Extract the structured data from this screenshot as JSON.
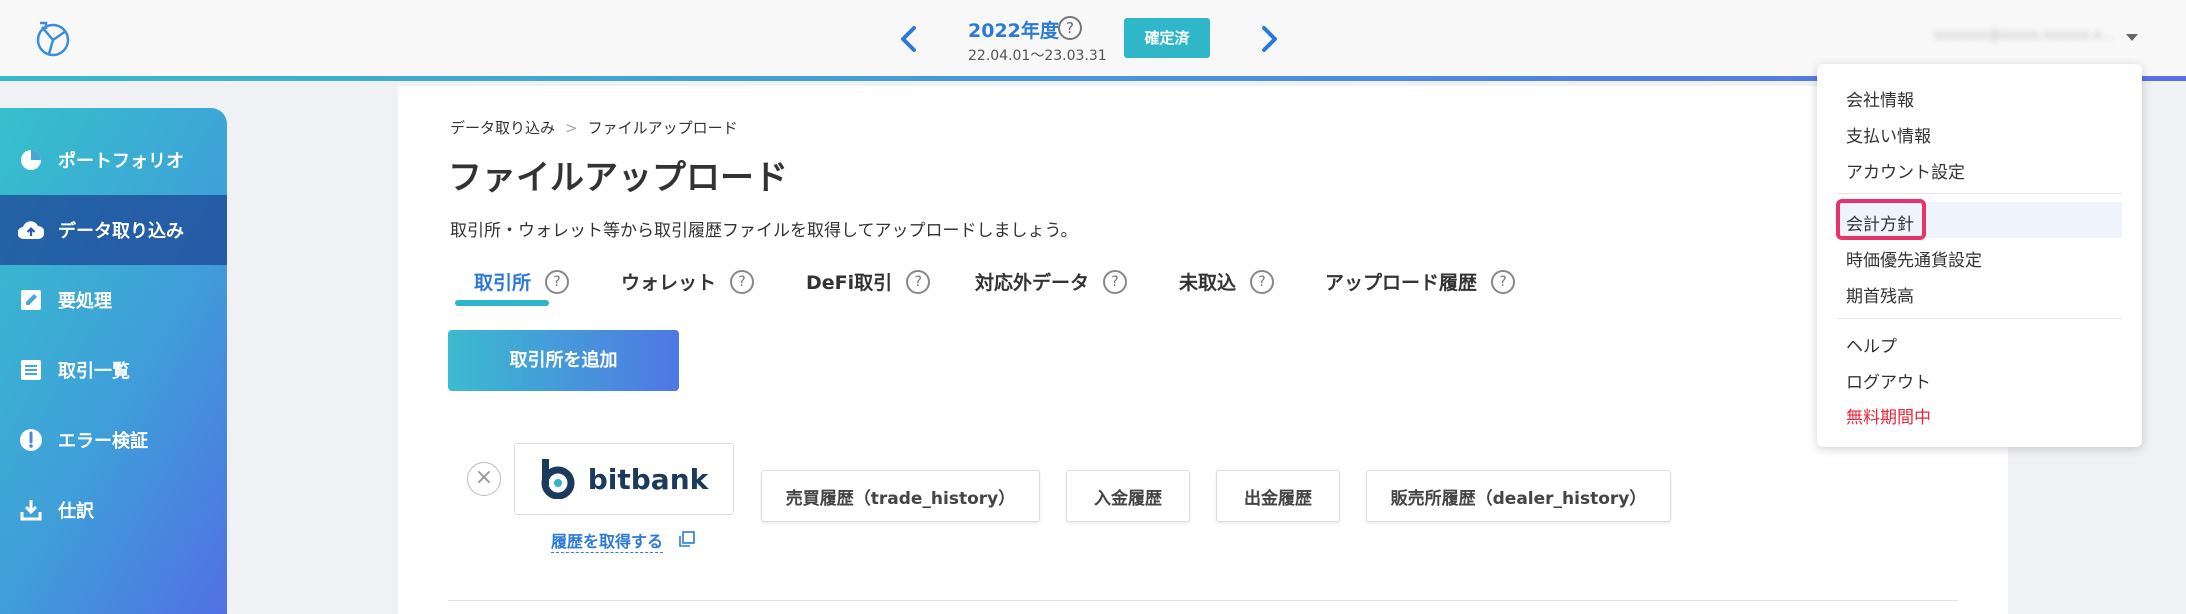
{
  "header": {
    "year_label": "2022年度",
    "year_help": "?",
    "period": "22.04.01〜23.03.31",
    "status_badge": "確定済",
    "user_email": "xxxxxxx@xxxxx.xxxxxx.x..."
  },
  "sidebar": {
    "items": [
      {
        "label": "ポートフォリオ",
        "icon": "pie-chart-icon",
        "active": false
      },
      {
        "label": "データ取り込み",
        "icon": "cloud-upload-icon",
        "active": true
      },
      {
        "label": "要処理",
        "icon": "edit-icon",
        "active": false
      },
      {
        "label": "取引一覧",
        "icon": "list-icon",
        "active": false
      },
      {
        "label": "エラー検証",
        "icon": "alert-icon",
        "active": false
      },
      {
        "label": "仕訳",
        "icon": "download-icon",
        "active": false
      }
    ]
  },
  "main": {
    "breadcrumb": [
      "データ取り込み",
      "ファイルアップロード"
    ],
    "breadcrumb_sep": ">",
    "title": "ファイルアップロード",
    "description": "取引所・ウォレット等から取引履歴ファイルを取得してアップロードしましょう。",
    "tabs": [
      {
        "label": "取引所",
        "help": "?"
      },
      {
        "label": "ウォレット",
        "help": "?"
      },
      {
        "label": "DeFi取引",
        "help": "?"
      },
      {
        "label": "対応外データ",
        "help": "?"
      },
      {
        "label": "未取込",
        "help": "?"
      },
      {
        "label": "アップロード履歴",
        "help": "?"
      }
    ],
    "add_button": "取引所を追加",
    "exchange": {
      "remove": "×",
      "logo_text": "bitbank",
      "get_history_link": "履歴を取得する",
      "history_buttons": [
        "売買履歴（trade_history）",
        "入金履歴",
        "出金履歴",
        "販売所履歴（dealer_history）"
      ]
    }
  },
  "dropdown": {
    "group1": [
      "会社情報",
      "支払い情報",
      "アカウント設定"
    ],
    "group2": [
      "会計方針",
      "時価優先通貨設定",
      "期首残高"
    ],
    "group3": [
      "ヘルプ",
      "ログアウト"
    ],
    "trial": "無料期間中"
  },
  "colors": {
    "accent": "#2c7ad6",
    "teal": "#2fb7c9",
    "highlight": "#e8326a",
    "warning": "#e8283a"
  }
}
